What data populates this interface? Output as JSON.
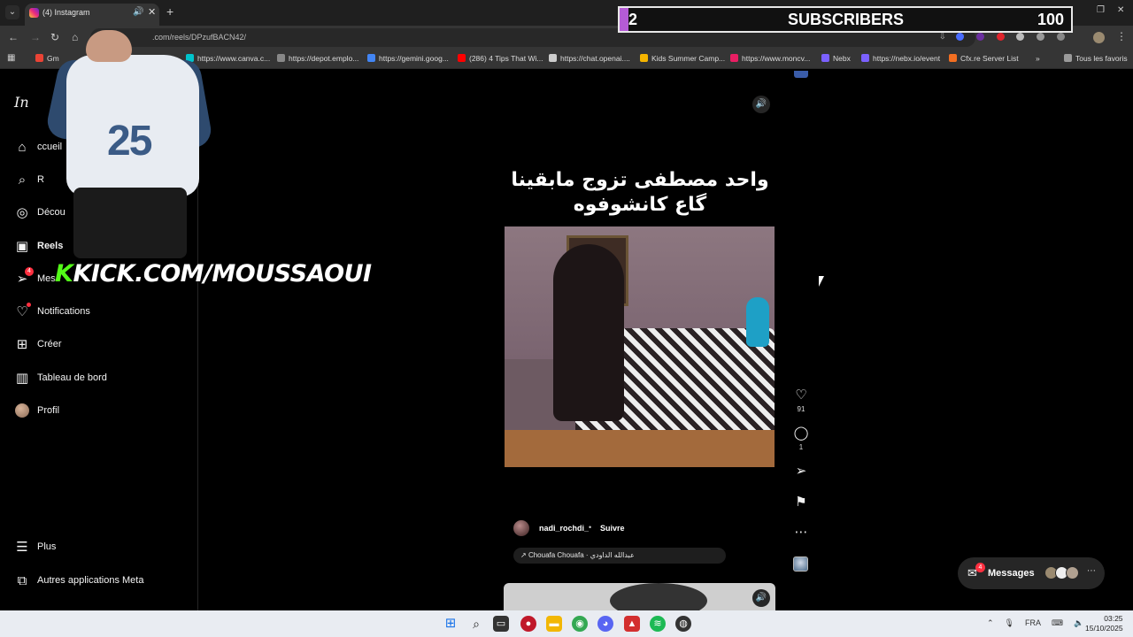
{
  "browser": {
    "tab_title": "(4) Instagram",
    "url": ".com/reels/DPzufBACN42/",
    "bookmarks": [
      {
        "label": "Gm",
        "color": "#ea4335"
      },
      {
        "label": "https://www.canva.c...",
        "color": "#00c4cc"
      },
      {
        "label": "https://depot.emplo...",
        "color": "#888888"
      },
      {
        "label": "https://gemini.goog...",
        "color": "#4285f4"
      },
      {
        "label": "(286) 4 Tips That Wi...",
        "color": "#ff0000"
      },
      {
        "label": "https://chat.openai....",
        "color": "#cccccc"
      },
      {
        "label": "Kids Summer Camp...",
        "color": "#f4b400"
      },
      {
        "label": "https://www.moncv...",
        "color": "#e91e63"
      },
      {
        "label": "Nebx",
        "color": "#7b61ff"
      },
      {
        "label": "https://nebx.io/event",
        "color": "#7b61ff"
      },
      {
        "label": "Cfx.re Server List",
        "color": "#f36f21"
      }
    ],
    "all_bookmarks_label": "Tous les favoris"
  },
  "sidebar": {
    "logo": "In",
    "items": [
      {
        "label": "ccueil",
        "icon": "home-icon"
      },
      {
        "label": "R",
        "icon": "search-icon"
      },
      {
        "label": "Décou",
        "icon": "compass-icon"
      },
      {
        "label": "Reels",
        "icon": "reels-icon"
      },
      {
        "label": "Mes",
        "icon": "send-icon",
        "badge": "4"
      },
      {
        "label": "Notifications",
        "icon": "heart-icon"
      },
      {
        "label": "Créer",
        "icon": "plus-square-icon"
      },
      {
        "label": "Tableau de bord",
        "icon": "chart-icon"
      },
      {
        "label": "Profil",
        "icon": "avatar-icon"
      }
    ],
    "bottom": [
      {
        "label": "Plus",
        "icon": "menu-icon"
      },
      {
        "label": "Autres applications Meta",
        "icon": "apps-icon"
      }
    ]
  },
  "overlay": {
    "jersey_number": "25",
    "kick_k": "K",
    "kick_text": "KICK.COM/MOUSSAOUI",
    "subscribers_count": "2",
    "subscribers_label": "SUBSCRIBERS",
    "subscribers_goal": "100",
    "subscribers_progress": 0.02
  },
  "reel": {
    "caption_line1": "واحد مصطفى تزوج مابقينا",
    "caption_line2": "گاع كانشوفوه",
    "author": "nadi_rochdi_",
    "separator": "•",
    "follow_label": "Suivre",
    "audio_label": "Chouafa Chouafa · عبدالله الداودي",
    "likes": "91",
    "comments": "1"
  },
  "messages": {
    "label": "Messages",
    "badge": "4"
  },
  "taskbar": {
    "language": "FRA",
    "time": "03:25",
    "date": "15/10/2025"
  }
}
